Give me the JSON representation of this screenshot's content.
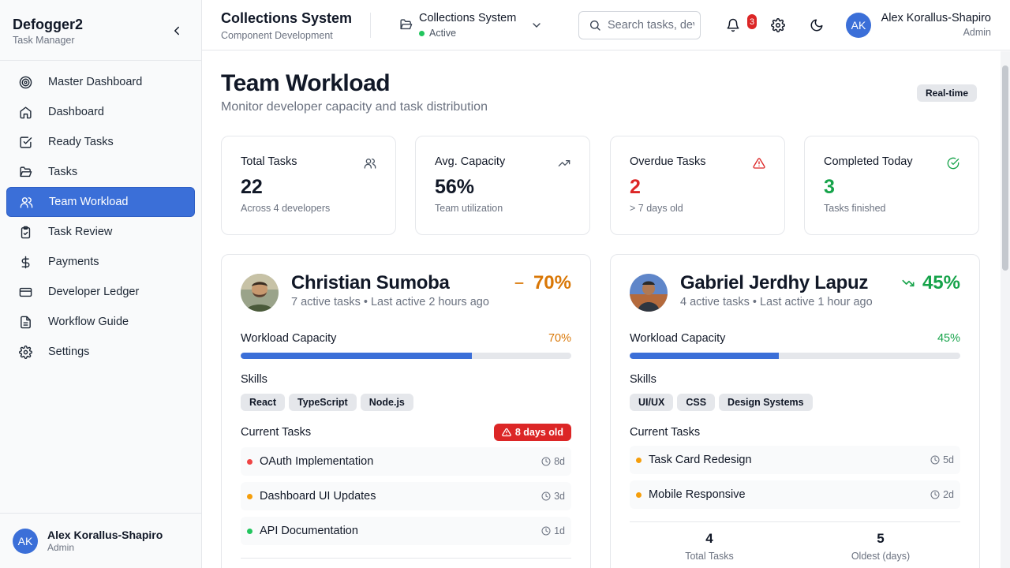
{
  "sidebar": {
    "brand_title": "Defogger2",
    "brand_sub": "Task Manager",
    "items": [
      {
        "label": "Master Dashboard",
        "icon": "target-icon"
      },
      {
        "label": "Dashboard",
        "icon": "home-icon"
      },
      {
        "label": "Ready Tasks",
        "icon": "checkbox-icon"
      },
      {
        "label": "Tasks",
        "icon": "folder-open-icon"
      },
      {
        "label": "Team Workload",
        "icon": "users-icon",
        "active": true
      },
      {
        "label": "Task Review",
        "icon": "clipboard-check-icon"
      },
      {
        "label": "Payments",
        "icon": "dollar-icon"
      },
      {
        "label": "Developer Ledger",
        "icon": "credit-card-icon"
      },
      {
        "label": "Workflow Guide",
        "icon": "file-text-icon"
      },
      {
        "label": "Settings",
        "icon": "gear-icon"
      }
    ],
    "user": {
      "initials": "AK",
      "name": "Alex Korallus-Shapiro",
      "role": "Admin"
    }
  },
  "header": {
    "title": "Collections System",
    "subtitle": "Component Development",
    "project": {
      "name": "Collections System",
      "status": "Active"
    },
    "search_placeholder": "Search tasks, developers...",
    "notification_count": "3",
    "user": {
      "initials": "AK",
      "name": "Alex Korallus-Shapiro",
      "role": "Admin"
    }
  },
  "page": {
    "title": "Team Workload",
    "subtitle": "Monitor developer capacity and task distribution",
    "badge": "Real-time"
  },
  "stats": [
    {
      "label": "Total Tasks",
      "value": "22",
      "note": "Across 4 developers",
      "icon": "users-icon",
      "color": "#111827"
    },
    {
      "label": "Avg. Capacity",
      "value": "56%",
      "note": "Team utilization",
      "icon": "trending-up-icon",
      "color": "#111827"
    },
    {
      "label": "Overdue Tasks",
      "value": "2",
      "note": "> 7 days old",
      "icon": "alert-triangle-icon",
      "color": "#dc2626"
    },
    {
      "label": "Completed Today",
      "value": "3",
      "note": "Tasks finished",
      "icon": "check-circle-icon",
      "color": "#16a34a"
    }
  ],
  "developers": [
    {
      "name": "Christian Sumoba",
      "meta": "7 active tasks • Last active 2 hours ago",
      "capacity_text": "70%",
      "capacity": 0.7,
      "color": "#d97706",
      "trend_icon": "minus-icon",
      "capacity_label": "Workload Capacity",
      "skills_label": "Skills",
      "skills": [
        "React",
        "TypeScript",
        "Node.js"
      ],
      "tasks_label": "Current Tasks",
      "overdue_badge": "8 days old",
      "tasks": [
        {
          "name": "OAuth Implementation",
          "age": "8d",
          "dot": "#ef4444"
        },
        {
          "name": "Dashboard UI Updates",
          "age": "3d",
          "dot": "#f59e0b"
        },
        {
          "name": "API Documentation",
          "age": "1d",
          "dot": "#22c55e"
        }
      ]
    },
    {
      "name": "Gabriel Jerdhy Lapuz",
      "meta": "4 active tasks • Last active 1 hour ago",
      "capacity_text": "45%",
      "capacity": 0.45,
      "color": "#16a34a",
      "trend_icon": "trending-down-icon",
      "capacity_label": "Workload Capacity",
      "skills_label": "Skills",
      "skills": [
        "UI/UX",
        "CSS",
        "Design Systems"
      ],
      "tasks_label": "Current Tasks",
      "tasks": [
        {
          "name": "Task Card Redesign",
          "age": "5d",
          "dot": "#f59e0b"
        },
        {
          "name": "Mobile Responsive",
          "age": "2d",
          "dot": "#f59e0b"
        }
      ],
      "summary": [
        {
          "value": "4",
          "label": "Total Tasks"
        },
        {
          "value": "5",
          "label": "Oldest (days)"
        }
      ]
    }
  ]
}
